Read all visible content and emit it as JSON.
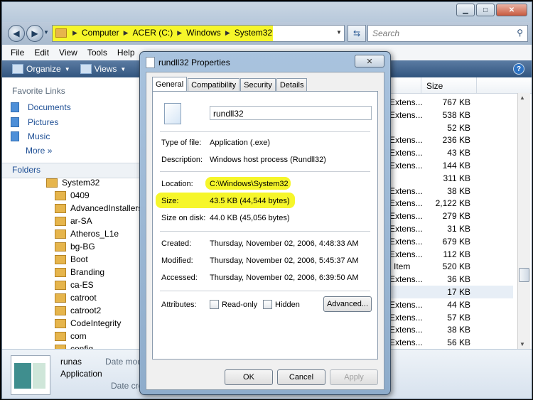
{
  "address": {
    "crumbs": [
      "Computer",
      "ACER (C:)",
      "Windows",
      "System32"
    ],
    "search_placeholder": "Search"
  },
  "menu": [
    "File",
    "Edit",
    "View",
    "Tools",
    "Help"
  ],
  "toolbar": {
    "organize": "Organize",
    "views": "Views"
  },
  "nav": {
    "favorites_header": "Favorite Links",
    "favorites": [
      "Documents",
      "Pictures",
      "Music"
    ],
    "more": "More",
    "folders_header": "Folders",
    "tree_root": "System32",
    "tree": [
      "0409",
      "AdvancedInstallers",
      "ar-SA",
      "Atheros_L1e",
      "bg-BG",
      "Boot",
      "Branding",
      "ca-ES",
      "catroot",
      "catroot2",
      "CodeIntegrity",
      "com",
      "config"
    ]
  },
  "filelist": {
    "size_header": "Size",
    "rows": [
      {
        "type": "Extens...",
        "size": "767 KB"
      },
      {
        "type": "Extens...",
        "size": "538 KB"
      },
      {
        "type": "",
        "size": "52 KB"
      },
      {
        "type": "Extens...",
        "size": "236 KB"
      },
      {
        "type": "Extens...",
        "size": "43 KB"
      },
      {
        "type": "Extens...",
        "size": "144 KB"
      },
      {
        "type": "",
        "size": "311 KB"
      },
      {
        "type": "Extens...",
        "size": "38 KB"
      },
      {
        "type": "Extens...",
        "size": "2,122 KB"
      },
      {
        "type": "Extens...",
        "size": "279 KB"
      },
      {
        "type": "Extens...",
        "size": "31 KB"
      },
      {
        "type": "Extens...",
        "size": "679 KB"
      },
      {
        "type": "Extens...",
        "size": "112 KB"
      },
      {
        "type": "l Item",
        "size": "520 KB"
      },
      {
        "type": "Extens...",
        "size": "36 KB"
      },
      {
        "type": "",
        "size": "17 KB"
      },
      {
        "type": "Extens...",
        "size": "44 KB"
      },
      {
        "type": "Extens...",
        "size": "57 KB"
      },
      {
        "type": "Extens...",
        "size": "38 KB"
      },
      {
        "type": "Extens...",
        "size": "56 KB"
      }
    ]
  },
  "status": {
    "name": "runas",
    "type": "Application",
    "date_modified": "Date modi",
    "date_created": "Date crea"
  },
  "dialog": {
    "title": "rundll32 Properties",
    "close": "✕",
    "tabs": [
      "General",
      "Compatibility",
      "Security",
      "Details"
    ],
    "filename": "rundll32",
    "type_label": "Type of file:",
    "type_value": "Application (.exe)",
    "desc_label": "Description:",
    "desc_value": "Windows host process (Rundll32)",
    "location_label": "Location:",
    "location_value": "C:\\Windows\\System32",
    "size_label": "Size:",
    "size_value": "43.5 KB (44,544 bytes)",
    "sizedisk_label": "Size on disk:",
    "sizedisk_value": "44.0 KB (45,056 bytes)",
    "created_label": "Created:",
    "created_value": "Thursday, November 02, 2006, 4:48:33 AM",
    "modified_label": "Modified:",
    "modified_value": "Thursday, November 02, 2006, 5:45:37 AM",
    "accessed_label": "Accessed:",
    "accessed_value": "Thursday, November 02, 2006, 6:39:50 AM",
    "attributes_label": "Attributes:",
    "readonly": "Read-only",
    "hidden": "Hidden",
    "advanced": "Advanced...",
    "ok": "OK",
    "cancel": "Cancel",
    "apply": "Apply"
  },
  "colors": {
    "highlight": "#f6f62a",
    "toolbar": "#3f6390",
    "link": "#1e4f95"
  }
}
